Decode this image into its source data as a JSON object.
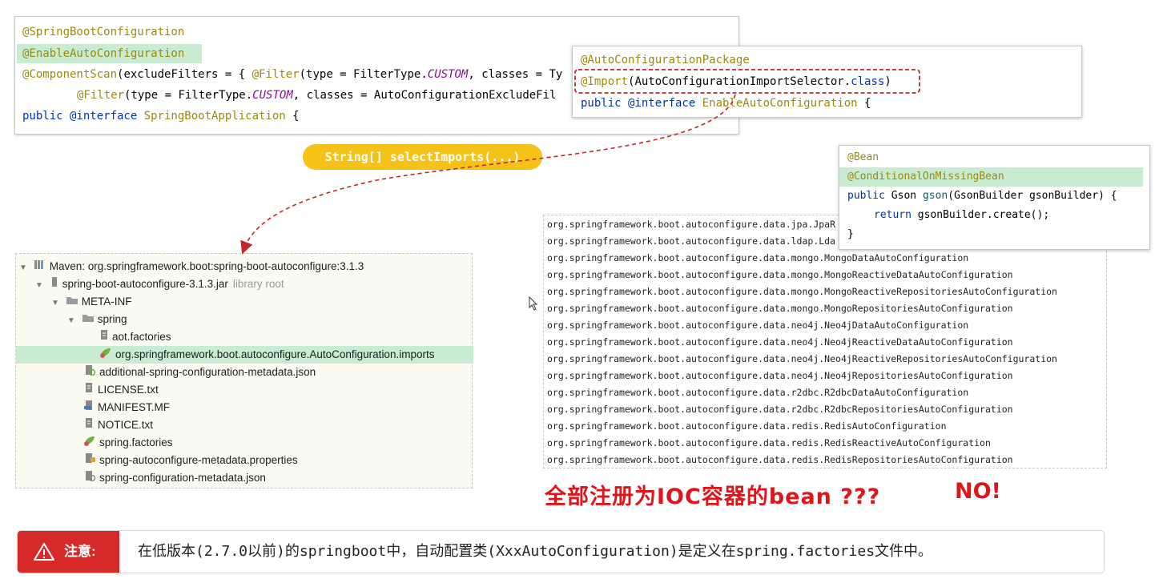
{
  "springboot_panel": {
    "line1": "@SpringBootConfiguration",
    "line2": "@EnableAutoConfiguration",
    "line3_ann": "@ComponentScan",
    "line3_rest": "(excludeFilters = { ",
    "line3_filter": "@Filter",
    "line3_mid": "(type = FilterType.",
    "line3_custom": "CUSTOM",
    "line3_end": ", classes = Ty",
    "line4_filter": "@Filter",
    "line4_mid": "(type = FilterType.",
    "line4_custom": "CUSTOM",
    "line4_end": ", classes = AutoConfigurationExcludeFil",
    "line5_kw": "public @interface ",
    "line5_cls": "SpringBootApplication",
    "line5_end": " {"
  },
  "enable_panel": {
    "line1": "@AutoConfigurationPackage",
    "line2_ann": "@Import",
    "line2_mid": "(AutoConfigurationImportSelector.",
    "line2_kw": "class",
    "line2_end": ")",
    "line3_kw": "public @interface ",
    "line3_cls": "EnableAutoConfiguration",
    "line3_end": " {"
  },
  "pill_label": "String[] selectImports(...)",
  "bean_panel": {
    "line1": "@Bean",
    "line2": "@ConditionalOnMissingBean",
    "line3_kw": "public ",
    "line3_rest": "Gson ",
    "line3_method": "gson",
    "line3_end": "(GsonBuilder gsonBuilder) {",
    "line4_kw": "return ",
    "line4_rest": "gsonBuilder.create();",
    "line5": "}"
  },
  "tree": {
    "root": "Maven: org.springframework.boot:spring-boot-autoconfigure:3.1.3",
    "jar": "spring-boot-autoconfigure-3.1.3.jar",
    "jar_suffix": "library root",
    "meta_inf": "META-INF",
    "spring": "spring",
    "aot": "aot.factories",
    "imports_file": "org.springframework.boot.autoconfigure.AutoConfiguration.imports",
    "additional": "additional-spring-configuration-metadata.json",
    "license": "LICENSE.txt",
    "manifest": "MANIFEST.MF",
    "notice": "NOTICE.txt",
    "spring_factories": "spring.factories",
    "metadata_props": "spring-autoconfigure-metadata.properties",
    "config_metadata": "spring-configuration-metadata.json"
  },
  "imports_list": [
    "org.springframework.boot.autoconfigure.data.jpa.JpaR",
    "org.springframework.boot.autoconfigure.data.ldap.Lda",
    "org.springframework.boot.autoconfigure.data.mongo.MongoDataAutoConfiguration",
    "org.springframework.boot.autoconfigure.data.mongo.MongoReactiveDataAutoConfiguration",
    "org.springframework.boot.autoconfigure.data.mongo.MongoReactiveRepositoriesAutoConfiguration",
    "org.springframework.boot.autoconfigure.data.mongo.MongoRepositoriesAutoConfiguration",
    "org.springframework.boot.autoconfigure.data.neo4j.Neo4jDataAutoConfiguration",
    "org.springframework.boot.autoconfigure.data.neo4j.Neo4jReactiveDataAutoConfiguration",
    "org.springframework.boot.autoconfigure.data.neo4j.Neo4jReactiveRepositoriesAutoConfiguration",
    "org.springframework.boot.autoconfigure.data.neo4j.Neo4jRepositoriesAutoConfiguration",
    "org.springframework.boot.autoconfigure.data.r2dbc.R2dbcDataAutoConfiguration",
    "org.springframework.boot.autoconfigure.data.r2dbc.R2dbcRepositoriesAutoConfiguration",
    "org.springframework.boot.autoconfigure.data.redis.RedisAutoConfiguration",
    "org.springframework.boot.autoconfigure.data.redis.RedisReactiveAutoConfiguration",
    "org.springframework.boot.autoconfigure.data.redis.RedisRepositoriesAutoConfiguration"
  ],
  "question": "全部注册为IOC容器的bean ???",
  "no": "NO!",
  "note": {
    "label": "注意:",
    "text": "在低版本(2.7.0以前)的springboot中，自动配置类(XxxAutoConfiguration)是定义在spring.factories文件中。"
  },
  "colors": {
    "annotation": "#9e880d",
    "highlight_green": "#c7ecd1",
    "pill_yellow": "#f6c218",
    "alert_red": "#d62a2a",
    "arrow_red": "#c0282a"
  }
}
